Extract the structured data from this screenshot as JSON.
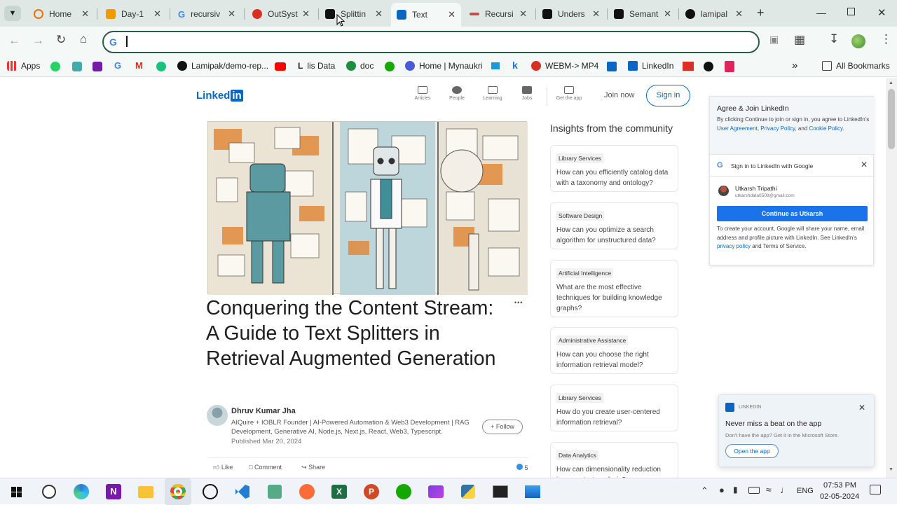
{
  "browser": {
    "tabs": [
      {
        "title": "Home",
        "color": "#e8710a"
      },
      {
        "title": "Day-1",
        "color": "#f29900"
      },
      {
        "title": "recursiv",
        "color": "#4285f4"
      },
      {
        "title": "OutSyst",
        "color": "#d93025"
      },
      {
        "title": "Splittin",
        "color": "#111111"
      },
      {
        "title": "Text",
        "color": "#0a66c2"
      },
      {
        "title": "Recursi",
        "color": "#c0504d"
      },
      {
        "title": "Unders",
        "color": "#111111"
      },
      {
        "title": "Semant",
        "color": "#111111"
      },
      {
        "title": "lamipal",
        "color": "#111111"
      }
    ],
    "omnibox_value": "",
    "bookmarks": [
      {
        "label": "Apps"
      },
      {
        "label": "Lamipak/demo-rep..."
      },
      {
        "label": "lis Data"
      },
      {
        "label": "doc"
      },
      {
        "label": "Home | Mynaukri"
      },
      {
        "label": "WEBM-> MP4"
      },
      {
        "label": "LinkedIn"
      }
    ],
    "all_bookmarks": "All Bookmarks"
  },
  "linkedin": {
    "logo": "Linked",
    "logo_in": "in",
    "nav": [
      "Articles",
      "People",
      "Learning",
      "Jobs",
      "Get the app"
    ],
    "join_now": "Join now",
    "sign_in": "Sign in"
  },
  "article": {
    "title": "Conquering the Content Stream: A Guide to Text Splitters in Retrieval Augmented Generation",
    "author": "Dhruv Kumar Jha",
    "headline": "AIQuire + IOBLR Founder | AI-Powered Automation & Web3 Development | RAG Development, Generative AI, Node.js, Next.js, React, Web3, Typescript.",
    "published": "Published Mar 20, 2024",
    "follow": "+ Follow",
    "actions": {
      "like": "Like",
      "comment": "Comment",
      "share": "Share",
      "count": "5"
    },
    "more": "•••"
  },
  "insights": {
    "heading": "Insights from the community",
    "items": [
      {
        "tag": "Library Services",
        "question": "How can you efficiently catalog data with a taxonomy and ontology?"
      },
      {
        "tag": "Software Design",
        "question": "How can you optimize a search algorithm for unstructured data?"
      },
      {
        "tag": "Artificial Intelligence",
        "question": "What are the most effective techniques for building knowledge graphs?"
      },
      {
        "tag": "Administrative Assistance",
        "question": "How can you choose the right information retrieval model?"
      },
      {
        "tag": "Library Services",
        "question": "How do you create user-centered information retrieval?"
      },
      {
        "tag": "Data Analytics",
        "question": "How can dimensionality reduction improve text analysis?"
      }
    ]
  },
  "join_panel": {
    "title": "Agree & Join LinkedIn",
    "text_pre": "By clicking Continue to join or sign in, you agree to LinkedIn's ",
    "user_agreement": "User Agreement",
    "privacy": "Privacy Policy",
    "and": ", and ",
    "cookie": "Cookie Policy",
    "google_title": "Sign in to LinkedIn with Google",
    "account_name": "Utkarsh Tripathi",
    "account_email": "utkarshdata0508@gmail.com",
    "continue": "Continue as Utkarsh",
    "footer_pre": "To create your account, Google will share your name, email address and profile picture with LinkedIn. See LinkedIn's ",
    "footer_link": "privacy policy",
    "footer_post": " and Terms of Service."
  },
  "toast": {
    "source": "LINKEDIN",
    "title": "Never miss a beat on the app",
    "body": "Don't have the app? Get it in the Microsoft Store.",
    "button": "Open the app"
  },
  "taskbar": {
    "lang": "ENG",
    "time": "07:53 PM",
    "date": "02-05-2024"
  }
}
